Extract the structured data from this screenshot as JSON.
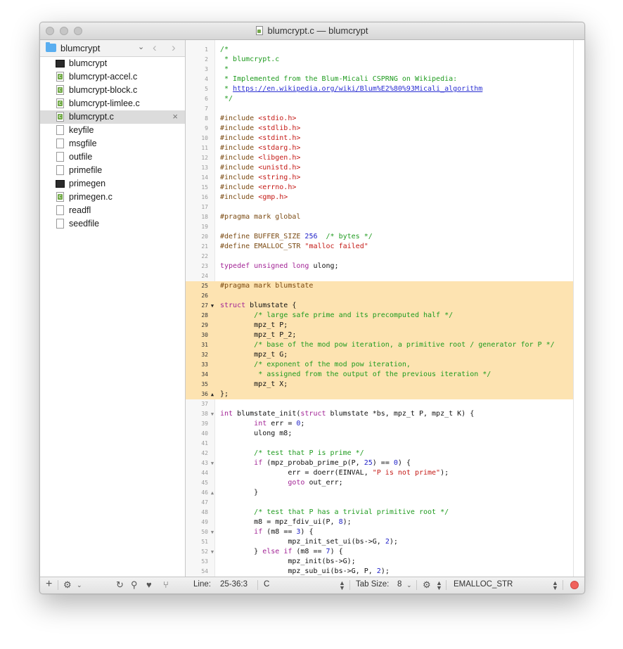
{
  "window": {
    "title": "blumcrypt.c — blumcrypt"
  },
  "sidebar": {
    "folder": "blumcrypt",
    "files": [
      {
        "name": "blumcrypt",
        "type": "exec"
      },
      {
        "name": "blumcrypt-accel.c",
        "type": "csrc"
      },
      {
        "name": "blumcrypt-block.c",
        "type": "csrc"
      },
      {
        "name": "blumcrypt-limlee.c",
        "type": "csrc"
      },
      {
        "name": "blumcrypt.c",
        "type": "csrc",
        "selected": true,
        "close": "×"
      },
      {
        "name": "keyfile",
        "type": "plain"
      },
      {
        "name": "msgfile",
        "type": "plain"
      },
      {
        "name": "outfile",
        "type": "plain"
      },
      {
        "name": "primefile",
        "type": "plain"
      },
      {
        "name": "primegen",
        "type": "exec"
      },
      {
        "name": "primegen.c",
        "type": "csrc"
      },
      {
        "name": "readfl",
        "type": "plain"
      },
      {
        "name": "seedfile",
        "type": "plain"
      }
    ]
  },
  "code": {
    "highlight_range": [
      25,
      36
    ],
    "lines": [
      {
        "n": "1",
        "fold": "",
        "t": [
          [
            "c",
            "/*"
          ]
        ]
      },
      {
        "n": "2",
        "fold": "",
        "t": [
          [
            "c",
            " * blumcrypt.c"
          ]
        ]
      },
      {
        "n": "3",
        "fold": "",
        "t": [
          [
            "c",
            " *"
          ]
        ]
      },
      {
        "n": "4",
        "fold": "",
        "t": [
          [
            "c",
            " * Implemented from the Blum-Micali CSPRNG on Wikipedia:"
          ]
        ]
      },
      {
        "n": "5",
        "fold": "",
        "t": [
          [
            "c",
            " * "
          ],
          [
            "u",
            "https://en.wikipedia.org/wiki/Blum%E2%80%93Micali_algorithm"
          ]
        ]
      },
      {
        "n": "6",
        "fold": "",
        "t": [
          [
            "c",
            " */"
          ]
        ]
      },
      {
        "n": "7",
        "fold": "",
        "t": []
      },
      {
        "n": "8",
        "fold": "",
        "t": [
          [
            "p",
            "#include "
          ],
          [
            "s",
            "<stdio.h>"
          ]
        ]
      },
      {
        "n": "9",
        "fold": "",
        "t": [
          [
            "p",
            "#include "
          ],
          [
            "s",
            "<stdlib.h>"
          ]
        ]
      },
      {
        "n": "10",
        "fold": "",
        "t": [
          [
            "p",
            "#include "
          ],
          [
            "s",
            "<stdint.h>"
          ]
        ]
      },
      {
        "n": "11",
        "fold": "",
        "t": [
          [
            "p",
            "#include "
          ],
          [
            "s",
            "<stdarg.h>"
          ]
        ]
      },
      {
        "n": "12",
        "fold": "",
        "t": [
          [
            "p",
            "#include "
          ],
          [
            "s",
            "<libgen.h>"
          ]
        ]
      },
      {
        "n": "13",
        "fold": "",
        "t": [
          [
            "p",
            "#include "
          ],
          [
            "s",
            "<unistd.h>"
          ]
        ]
      },
      {
        "n": "14",
        "fold": "",
        "t": [
          [
            "p",
            "#include "
          ],
          [
            "s",
            "<string.h>"
          ]
        ]
      },
      {
        "n": "15",
        "fold": "",
        "t": [
          [
            "p",
            "#include "
          ],
          [
            "s",
            "<errno.h>"
          ]
        ]
      },
      {
        "n": "16",
        "fold": "",
        "t": [
          [
            "p",
            "#include "
          ],
          [
            "s",
            "<gmp.h>"
          ]
        ]
      },
      {
        "n": "17",
        "fold": "",
        "t": []
      },
      {
        "n": "18",
        "fold": "",
        "t": [
          [
            "p",
            "#pragma mark global"
          ]
        ]
      },
      {
        "n": "19",
        "fold": "",
        "t": []
      },
      {
        "n": "20",
        "fold": "",
        "t": [
          [
            "p",
            "#define BUFFER_SIZE "
          ],
          [
            "n",
            "256"
          ],
          [
            "x",
            "  "
          ],
          [
            "c",
            "/* bytes */"
          ]
        ]
      },
      {
        "n": "21",
        "fold": "",
        "t": [
          [
            "p",
            "#define EMALLOC_STR "
          ],
          [
            "s",
            "\"malloc failed\""
          ]
        ]
      },
      {
        "n": "22",
        "fold": "",
        "t": []
      },
      {
        "n": "23",
        "fold": "",
        "t": [
          [
            "k",
            "typedef unsigned long"
          ],
          [
            "x",
            " ulong;"
          ]
        ]
      },
      {
        "n": "24",
        "fold": "",
        "t": []
      },
      {
        "n": "25",
        "fold": "",
        "t": [
          [
            "p",
            "#pragma mark blumstate"
          ]
        ]
      },
      {
        "n": "26",
        "fold": "",
        "t": []
      },
      {
        "n": "27",
        "fold": "▼",
        "t": [
          [
            "k",
            "struct"
          ],
          [
            "x",
            " blumstate {"
          ]
        ]
      },
      {
        "n": "28",
        "fold": "",
        "t": [
          [
            "x",
            "        "
          ],
          [
            "c",
            "/* large safe prime and its precomputed half */"
          ]
        ]
      },
      {
        "n": "29",
        "fold": "",
        "t": [
          [
            "x",
            "        mpz_t P;"
          ]
        ]
      },
      {
        "n": "30",
        "fold": "",
        "t": [
          [
            "x",
            "        mpz_t P_2;"
          ]
        ]
      },
      {
        "n": "31",
        "fold": "",
        "t": [
          [
            "x",
            "        "
          ],
          [
            "c",
            "/* base of the mod pow iteration, a primitive root / generator for P */"
          ]
        ]
      },
      {
        "n": "32",
        "fold": "",
        "t": [
          [
            "x",
            "        mpz_t G;"
          ]
        ]
      },
      {
        "n": "33",
        "fold": "",
        "t": [
          [
            "x",
            "        "
          ],
          [
            "c",
            "/* exponent of the mod pow iteration,"
          ]
        ]
      },
      {
        "n": "34",
        "fold": "",
        "t": [
          [
            "x",
            "        "
          ],
          [
            "c",
            " * assigned from the output of the previous iteration */"
          ]
        ]
      },
      {
        "n": "35",
        "fold": "",
        "t": [
          [
            "x",
            "        mpz_t X;"
          ]
        ]
      },
      {
        "n": "36",
        "fold": "▲",
        "t": [
          [
            "x",
            "};"
          ]
        ]
      },
      {
        "n": "37",
        "fold": "",
        "t": []
      },
      {
        "n": "38",
        "fold": "▼",
        "t": [
          [
            "k",
            "int"
          ],
          [
            "x",
            " blumstate_init("
          ],
          [
            "k",
            "struct"
          ],
          [
            "x",
            " blumstate *bs, mpz_t P, mpz_t K) {"
          ]
        ]
      },
      {
        "n": "39",
        "fold": "",
        "t": [
          [
            "x",
            "        "
          ],
          [
            "k",
            "int"
          ],
          [
            "x",
            " err = "
          ],
          [
            "n",
            "0"
          ],
          [
            "x",
            ";"
          ]
        ]
      },
      {
        "n": "40",
        "fold": "",
        "t": [
          [
            "x",
            "        ulong m8;"
          ]
        ]
      },
      {
        "n": "41",
        "fold": "",
        "t": []
      },
      {
        "n": "42",
        "fold": "",
        "t": [
          [
            "x",
            "        "
          ],
          [
            "c",
            "/* test that P is prime */"
          ]
        ]
      },
      {
        "n": "43",
        "fold": "▼",
        "t": [
          [
            "x",
            "        "
          ],
          [
            "k",
            "if"
          ],
          [
            "x",
            " (mpz_probab_prime_p(P, "
          ],
          [
            "n",
            "25"
          ],
          [
            "x",
            ") == "
          ],
          [
            "n",
            "0"
          ],
          [
            "x",
            ") {"
          ]
        ]
      },
      {
        "n": "44",
        "fold": "",
        "t": [
          [
            "x",
            "                err = doerr(EINVAL, "
          ],
          [
            "s",
            "\"P is not prime\""
          ],
          [
            "x",
            ");"
          ]
        ]
      },
      {
        "n": "45",
        "fold": "",
        "t": [
          [
            "x",
            "                "
          ],
          [
            "k",
            "goto"
          ],
          [
            "x",
            " out_err;"
          ]
        ]
      },
      {
        "n": "46",
        "fold": "▲",
        "t": [
          [
            "x",
            "        }"
          ]
        ]
      },
      {
        "n": "47",
        "fold": "",
        "t": []
      },
      {
        "n": "48",
        "fold": "",
        "t": [
          [
            "x",
            "        "
          ],
          [
            "c",
            "/* test that P has a trivial primitive root */"
          ]
        ]
      },
      {
        "n": "49",
        "fold": "",
        "t": [
          [
            "x",
            "        m8 = mpz_fdiv_ui(P, "
          ],
          [
            "n",
            "8"
          ],
          [
            "x",
            ");"
          ]
        ]
      },
      {
        "n": "50",
        "fold": "▼",
        "t": [
          [
            "x",
            "        "
          ],
          [
            "k",
            "if"
          ],
          [
            "x",
            " (m8 == "
          ],
          [
            "n",
            "3"
          ],
          [
            "x",
            ") {"
          ]
        ]
      },
      {
        "n": "51",
        "fold": "",
        "t": [
          [
            "x",
            "                mpz_init_set_ui(bs->G, "
          ],
          [
            "n",
            "2"
          ],
          [
            "x",
            ");"
          ]
        ]
      },
      {
        "n": "52",
        "fold": "▼",
        "t": [
          [
            "x",
            "        } "
          ],
          [
            "k",
            "else if"
          ],
          [
            "x",
            " (m8 == "
          ],
          [
            "n",
            "7"
          ],
          [
            "x",
            ") {"
          ]
        ]
      },
      {
        "n": "53",
        "fold": "",
        "t": [
          [
            "x",
            "                mpz_init(bs->G);"
          ]
        ]
      },
      {
        "n": "54",
        "fold": "",
        "t": [
          [
            "x",
            "                mpz_sub_ui(bs->G, P, "
          ],
          [
            "n",
            "2"
          ],
          [
            "x",
            ");"
          ]
        ]
      }
    ]
  },
  "statusbar": {
    "line_label": "Line:",
    "line_value": "25-36:3",
    "language": "C",
    "tab_size_label": "Tab Size:",
    "tab_size_value": "8",
    "symbol": "EMALLOC_STR"
  }
}
